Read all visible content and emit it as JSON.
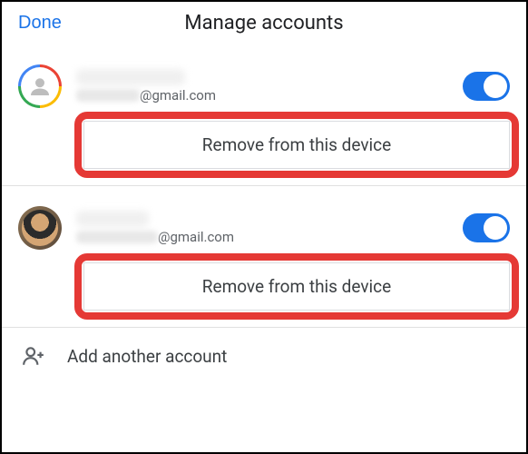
{
  "header": {
    "done_label": "Done",
    "title": "Manage accounts"
  },
  "accounts": [
    {
      "avatar_type": "google-ring",
      "email_suffix": "@gmail.com",
      "toggle_on": true,
      "remove_label": "Remove from this device"
    },
    {
      "avatar_type": "photo",
      "email_suffix": "@gmail.com",
      "toggle_on": true,
      "remove_label": "Remove from this device"
    }
  ],
  "add_account": {
    "label": "Add another account"
  }
}
